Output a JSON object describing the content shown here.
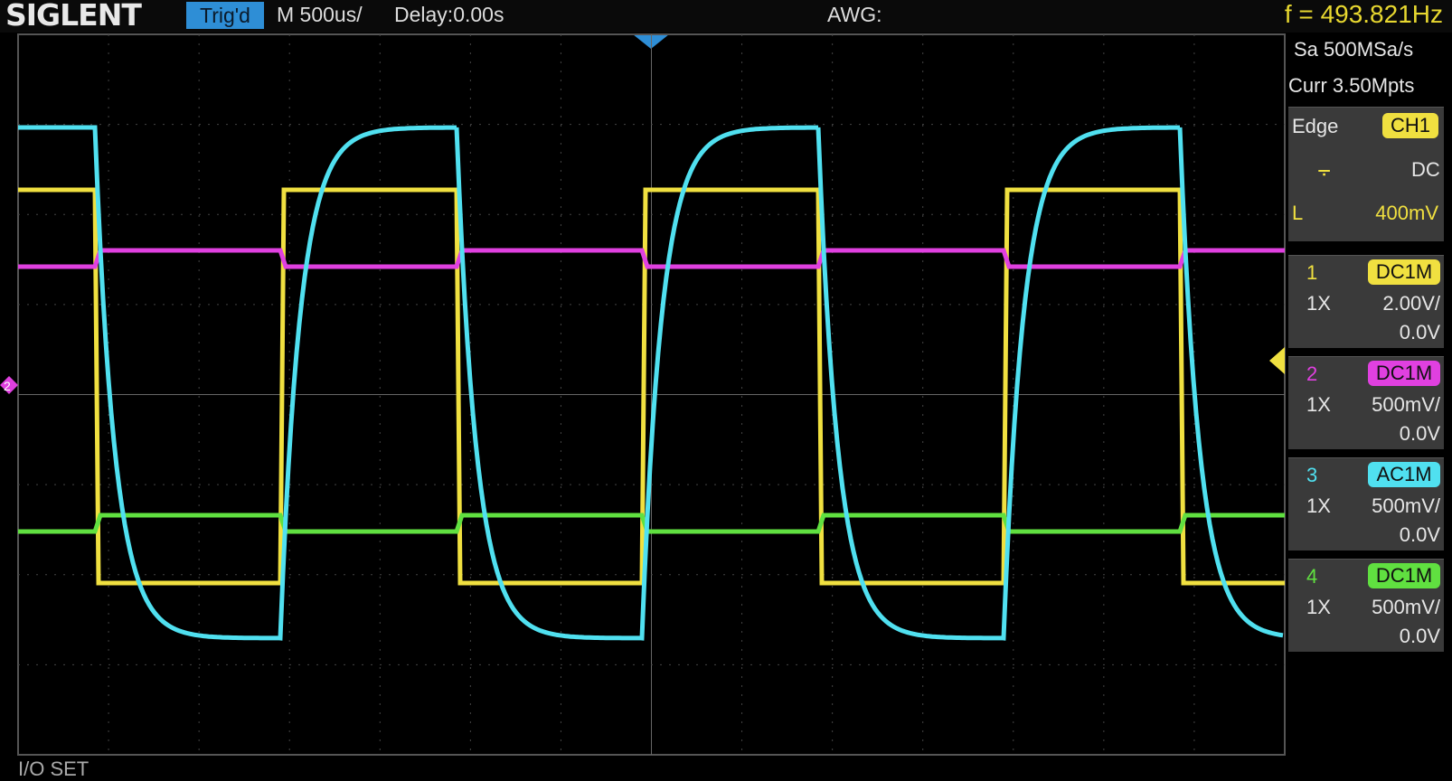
{
  "header": {
    "brand": "SIGLENT",
    "trigger_state": "Trig'd",
    "timebase": "M 500us/",
    "delay": "Delay:0.00s",
    "awg": "AWG:",
    "frequency": "f = 493.821Hz"
  },
  "acquisition": {
    "sample_rate": "Sa 500MSa/s",
    "memory": "Curr 3.50Mpts"
  },
  "trigger": {
    "type": "Edge",
    "source": "CH1",
    "slope_icon": "rising-edge-icon",
    "coupling": "DC",
    "level_label": "L",
    "level": "400mV"
  },
  "channels": [
    {
      "number": "1",
      "coupling": "DC1M",
      "probe": "1X",
      "scale": "2.00V/",
      "offset": "0.0V",
      "color": "#f0e040"
    },
    {
      "number": "2",
      "coupling": "DC1M",
      "probe": "1X",
      "scale": "500mV/",
      "offset": "0.0V",
      "color": "#e040e0"
    },
    {
      "number": "3",
      "coupling": "AC1M",
      "probe": "1X",
      "scale": "500mV/",
      "offset": "0.0V",
      "color": "#50e0f0"
    },
    {
      "number": "4",
      "coupling": "DC1M",
      "probe": "1X",
      "scale": "500mV/",
      "offset": "0.0V",
      "color": "#60e040"
    }
  ],
  "markers": {
    "ch2_marker": "2"
  },
  "bottom_label": "I/O SET"
}
